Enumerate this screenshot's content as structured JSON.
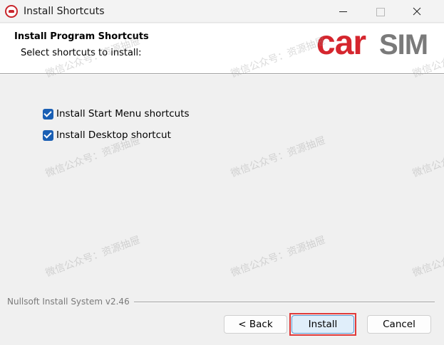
{
  "window": {
    "title": "Install Shortcuts"
  },
  "header": {
    "title": "Install Program Shortcuts",
    "subtitle": "Select shortcuts to install:",
    "logo_text": "carSIM"
  },
  "options": [
    {
      "label": "Install Start Menu shortcuts",
      "checked": true
    },
    {
      "label": "Install Desktop shortcut",
      "checked": true
    }
  ],
  "footer": {
    "branding": "Nullsoft Install System v2.46",
    "back_label": "< Back",
    "install_label": "Install",
    "cancel_label": "Cancel"
  },
  "watermark": {
    "text": "微信公众号：资源抽屉"
  },
  "colors": {
    "accent": "#1a5fb4",
    "logo_red": "#d5262e",
    "logo_gray": "#7a7a7a",
    "highlight": "#e03a3a"
  }
}
